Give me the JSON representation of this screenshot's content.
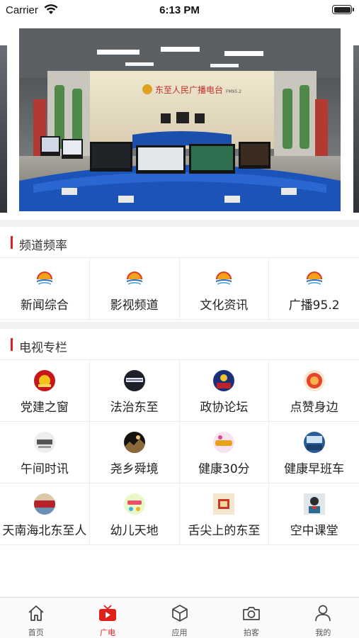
{
  "status_bar": {
    "carrier": "Carrier",
    "time": "6:13 PM"
  },
  "banner": {
    "studio_sign": "东至人民广播电台",
    "studio_sign_sub": "FM95.2"
  },
  "sections": [
    {
      "title": "频道频率",
      "items": [
        {
          "label": "新闻综合",
          "icon": "station-logo-icon"
        },
        {
          "label": "影视频道",
          "icon": "station-logo-icon"
        },
        {
          "label": "文化资讯",
          "icon": "station-logo-icon"
        },
        {
          "label": "广播95.2",
          "icon": "station-logo-icon"
        }
      ]
    },
    {
      "title": "电视专栏",
      "items": [
        {
          "label": "党建之窗",
          "icon": "party-building-thumbnail"
        },
        {
          "label": "法治东至",
          "icon": "rule-of-law-thumbnail"
        },
        {
          "label": "政协论坛",
          "icon": "cppcc-forum-thumbnail"
        },
        {
          "label": "点赞身边",
          "icon": "praise-nearby-thumbnail"
        },
        {
          "label": "午间时讯",
          "icon": "noon-news-thumbnail"
        },
        {
          "label": "尧乡舜境",
          "icon": "yao-xiang-thumbnail"
        },
        {
          "label": "健康30分",
          "icon": "health-30-thumbnail"
        },
        {
          "label": "健康早班车",
          "icon": "health-morning-thumbnail"
        },
        {
          "label": "天南海北东至人",
          "icon": "dongzhi-people-thumbnail"
        },
        {
          "label": "幼儿天地",
          "icon": "kids-world-thumbnail"
        },
        {
          "label": "舌尖上的东至",
          "icon": "dongzhi-food-thumbnail"
        },
        {
          "label": "空中课堂",
          "icon": "air-classroom-thumbnail"
        }
      ]
    }
  ],
  "tabs": [
    {
      "label": "首页",
      "icon": "home-icon",
      "active": false
    },
    {
      "label": "广电",
      "icon": "tv-play-icon",
      "active": true
    },
    {
      "label": "应用",
      "icon": "apps-box-icon",
      "active": false
    },
    {
      "label": "拍客",
      "icon": "camera-icon",
      "active": false
    },
    {
      "label": "我的",
      "icon": "user-icon",
      "active": false
    }
  ],
  "colors": {
    "accent": "#e0201c",
    "divider": "#f1f1f1"
  }
}
